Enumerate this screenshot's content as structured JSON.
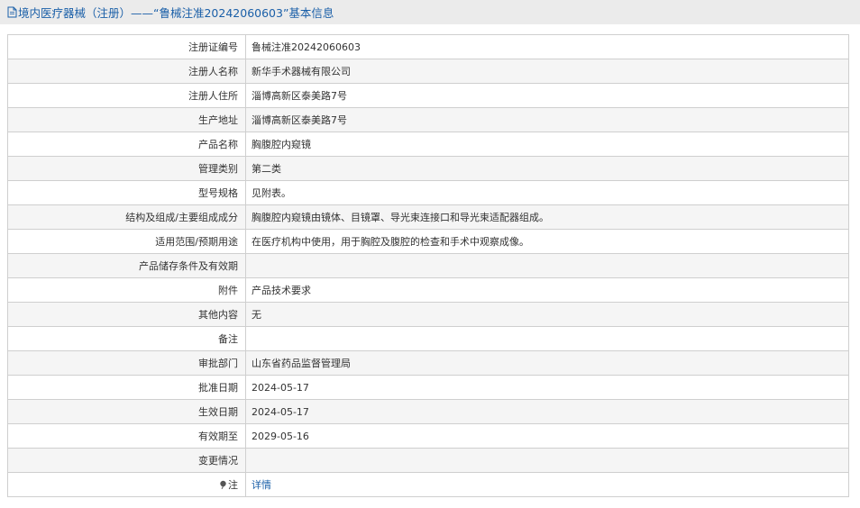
{
  "header": {
    "title": "境内医疗器械（注册）——“鲁械注准20242060603”基本信息",
    "icon": "document-icon"
  },
  "rows": [
    {
      "label": "注册证编号",
      "value": "鲁械注准20242060603"
    },
    {
      "label": "注册人名称",
      "value": "新华手术器械有限公司"
    },
    {
      "label": "注册人住所",
      "value": "淄博高新区泰美路7号"
    },
    {
      "label": "生产地址",
      "value": "淄博高新区泰美路7号"
    },
    {
      "label": "产品名称",
      "value": "胸腹腔内窥镜"
    },
    {
      "label": "管理类别",
      "value": "第二类"
    },
    {
      "label": "型号规格",
      "value": "见附表。"
    },
    {
      "label": "结构及组成/主要组成成分",
      "value": "胸腹腔内窥镜由镜体、目镜罩、导光束连接口和导光束适配器组成。"
    },
    {
      "label": "适用范围/预期用途",
      "value": "在医疗机构中使用，用于胸腔及腹腔的检查和手术中观察成像。"
    },
    {
      "label": "产品储存条件及有效期",
      "value": ""
    },
    {
      "label": "附件",
      "value": "产品技术要求"
    },
    {
      "label": "其他内容",
      "value": "无"
    },
    {
      "label": "备注",
      "value": ""
    },
    {
      "label": "审批部门",
      "value": "山东省药品监督管理局"
    },
    {
      "label": "批准日期",
      "value": "2024-05-17"
    },
    {
      "label": "生效日期",
      "value": "2024-05-17"
    },
    {
      "label": "有效期至",
      "value": "2029-05-16"
    },
    {
      "label": "变更情况",
      "value": ""
    }
  ],
  "note_row": {
    "label": "注",
    "icon": "pin-icon",
    "link_text": "详情"
  },
  "colors": {
    "link": "#1a5fa8",
    "header_bg": "#ebebeb",
    "border": "#cfcfcf",
    "alt_row": "#f5f5f5"
  }
}
